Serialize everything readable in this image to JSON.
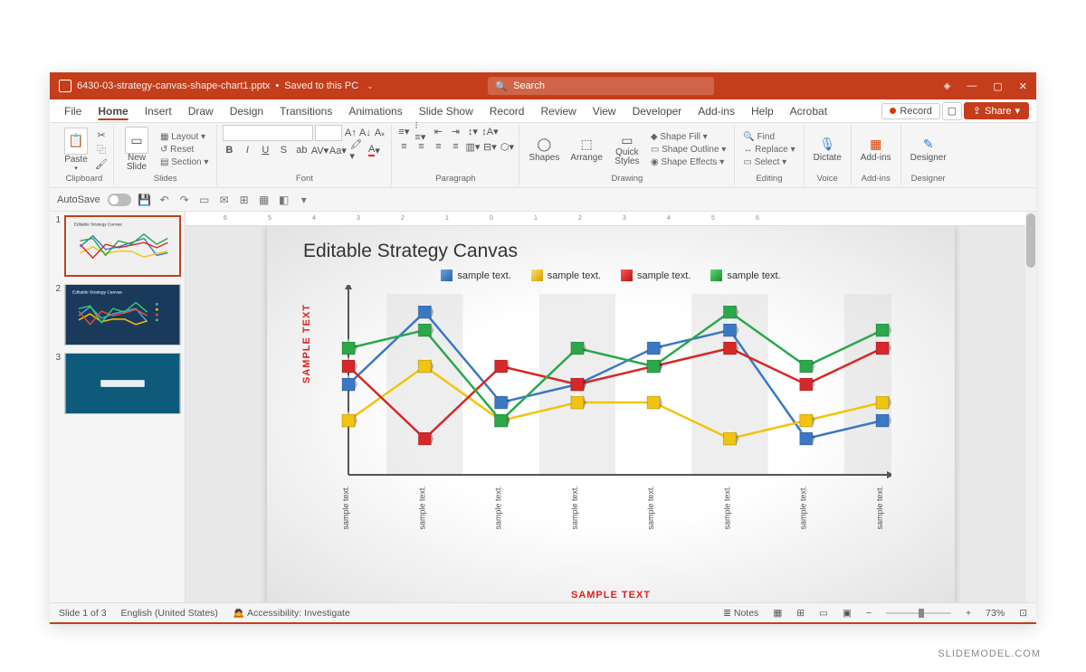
{
  "titlebar": {
    "filename": "6430-03-strategy-canvas-shape-chart1.pptx",
    "save_state": "Saved to this PC",
    "search_placeholder": "Search"
  },
  "tabs": [
    "File",
    "Home",
    "Insert",
    "Draw",
    "Design",
    "Transitions",
    "Animations",
    "Slide Show",
    "Record",
    "Review",
    "View",
    "Developer",
    "Add-ins",
    "Help",
    "Acrobat"
  ],
  "active_tab": "Home",
  "tabbar_right": {
    "record": "Record",
    "share": "Share"
  },
  "ribbon": {
    "clipboard_label": "Clipboard",
    "paste": "Paste",
    "slides_label": "Slides",
    "new_slide": "New Slide",
    "layout": "Layout",
    "reset": "Reset",
    "section": "Section",
    "font_label": "Font",
    "paragraph_label": "Paragraph",
    "drawing_label": "Drawing",
    "shapes": "Shapes",
    "arrange": "Arrange",
    "quick_styles": "Quick Styles",
    "shape_fill": "Shape Fill",
    "shape_outline": "Shape Outline",
    "shape_effects": "Shape Effects",
    "editing_label": "Editing",
    "find": "Find",
    "replace": "Replace",
    "select": "Select",
    "voice_label": "Voice",
    "dictate": "Dictate",
    "addins_label": "Add-ins",
    "addins": "Add-ins",
    "designer_label": "Designer",
    "designer": "Designer"
  },
  "qat": {
    "autosave": "AutoSave",
    "autosave_state": "Off"
  },
  "ruler_ticks": [
    "6",
    "5",
    "4",
    "3",
    "2",
    "1",
    "0",
    "1",
    "2",
    "3",
    "4",
    "5",
    "6"
  ],
  "slide": {
    "title": "Editable Strategy Canvas",
    "legend": [
      {
        "label": "sample text.",
        "color": "#3b78c4"
      },
      {
        "label": "sample text.",
        "color": "#f2c40f"
      },
      {
        "label": "sample text.",
        "color": "#d62828"
      },
      {
        "label": "sample text.",
        "color": "#2ba84a"
      }
    ],
    "ylabel": "SAMPLE TEXT",
    "xlabel": "SAMPLE TEXT",
    "x_categories": [
      "sample text.",
      "sample text.",
      "sample text.",
      "sample text.",
      "sample text.",
      "sample text.",
      "sample text.",
      "sample text."
    ]
  },
  "thumbnails": {
    "count": 3,
    "selected": 1
  },
  "statusbar": {
    "slide_of": "Slide 1 of 3",
    "language": "English (United States)",
    "accessibility": "Accessibility: Investigate",
    "notes": "Notes",
    "zoom": "73%"
  },
  "watermark": "SLIDEMODEL.COM",
  "chart_data": {
    "type": "line",
    "title": "Editable Strategy Canvas",
    "xlabel": "SAMPLE TEXT",
    "ylabel": "SAMPLE TEXT",
    "ylim": [
      0,
      10
    ],
    "categories": [
      "sample text.",
      "sample text.",
      "sample text.",
      "sample text.",
      "sample text.",
      "sample text.",
      "sample text.",
      "sample text."
    ],
    "series": [
      {
        "name": "sample text.",
        "color": "#3b78c4",
        "values": [
          5,
          9,
          4,
          5,
          7,
          8,
          2,
          3
        ]
      },
      {
        "name": "sample text.",
        "color": "#f2c40f",
        "values": [
          3,
          6,
          3,
          4,
          4,
          2,
          3,
          4
        ]
      },
      {
        "name": "sample text.",
        "color": "#d62828",
        "values": [
          6,
          2,
          6,
          5,
          6,
          7,
          5,
          7
        ]
      },
      {
        "name": "sample text.",
        "color": "#2ba84a",
        "values": [
          7,
          8,
          3,
          7,
          6,
          9,
          6,
          8
        ]
      }
    ]
  }
}
